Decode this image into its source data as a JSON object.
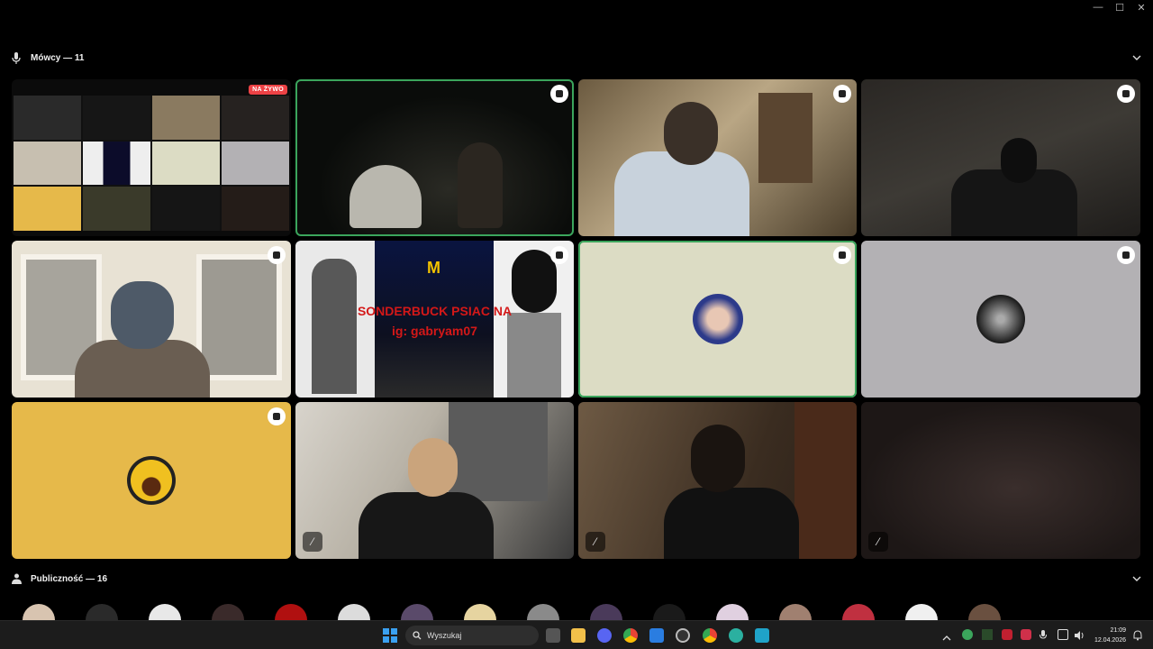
{
  "speakers_header": {
    "title": "Mówcy — 11"
  },
  "audience_header": {
    "title": "Publiczność — 16"
  },
  "live_badge": "NA ŻYWO",
  "overlay": {
    "line1": "SONDERBUCK PSIAC NA",
    "line2": "ig: gabryam07"
  },
  "taskbar": {
    "search_placeholder": "Wyszukaj",
    "time": "21:09",
    "date": "12.04.2026"
  },
  "colors": {
    "speaking_outline": "#3ba55c",
    "live_badge": "#ed4245",
    "yellow_tile": "#e6b94a",
    "beige_tile": "#dcdcc4",
    "grey_tile": "#b3b1b4"
  }
}
